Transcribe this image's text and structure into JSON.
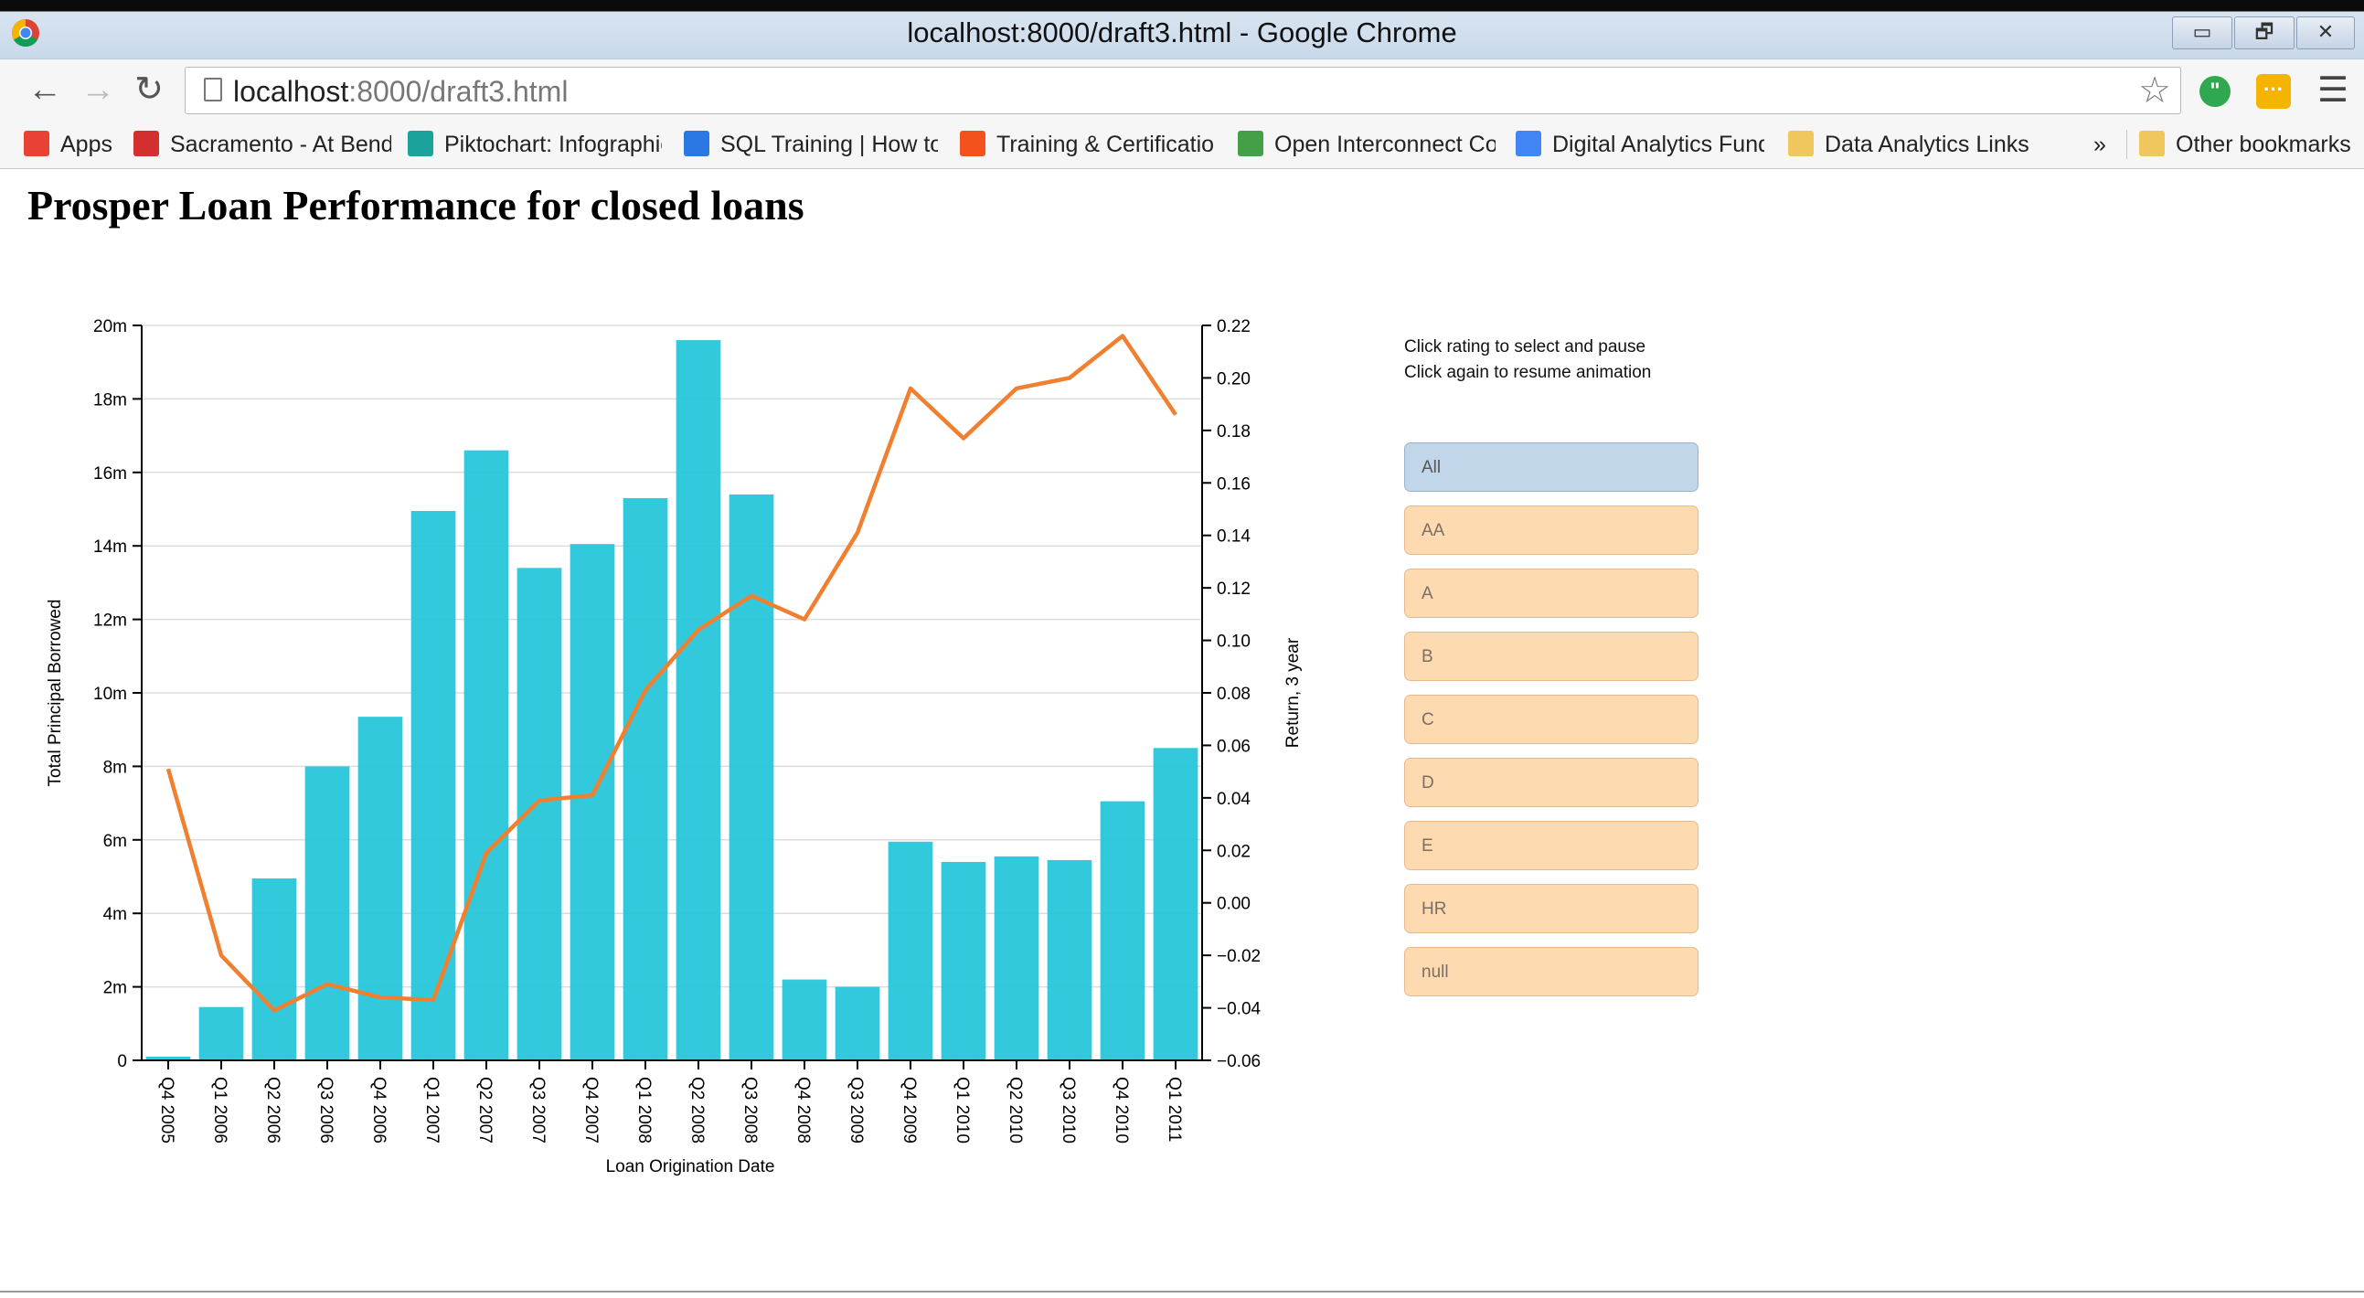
{
  "window": {
    "title": "localhost:8000/draft3.html - Google Chrome",
    "controls": [
      "▭",
      "🗗",
      "✕"
    ]
  },
  "nav": {
    "back": "←",
    "forward": "→",
    "reload": "↻"
  },
  "address_bar": {
    "host": "localhost",
    "path": ":8000/draft3.html"
  },
  "bookmarks": {
    "items": [
      {
        "label": "Apps",
        "icon_color": "#e94235"
      },
      {
        "label": "Sacramento - At Bend",
        "icon_color": "#d32f2f"
      },
      {
        "label": "Piktochart: Infographic",
        "icon_color": "#1aa39a"
      },
      {
        "label": "SQL Training | How to",
        "icon_color": "#2b78e4"
      },
      {
        "label": "Training & Certificatio",
        "icon_color": "#f4511e"
      },
      {
        "label": "Open Interconnect Co",
        "icon_color": "#43a047"
      },
      {
        "label": "Digital Analytics Fund",
        "icon_color": "#4285f4"
      },
      {
        "label": "Data Analytics Links",
        "icon_color": "#f0c75e"
      }
    ],
    "overflow": "»",
    "other": {
      "label": "Other bookmarks",
      "icon_color": "#f0c75e"
    }
  },
  "page": {
    "title": "Prosper Loan Performance for closed loans",
    "instructions": [
      "Click rating to select and pause",
      "Click again to resume animation"
    ],
    "ratings": [
      "All",
      "AA",
      "A",
      "B",
      "C",
      "D",
      "E",
      "HR",
      "null"
    ],
    "selected_rating": "All"
  },
  "chart_data": {
    "type": "bar",
    "xlabel": "Loan Origination Date",
    "ylabel": "Total Principal Borrowed",
    "y2label": "Return, 3 year",
    "categories": [
      "Q4 2005",
      "Q1 2006",
      "Q2 2006",
      "Q3 2006",
      "Q4 2006",
      "Q1 2007",
      "Q2 2007",
      "Q3 2007",
      "Q4 2007",
      "Q1 2008",
      "Q2 2008",
      "Q3 2008",
      "Q4 2008",
      "Q3 2009",
      "Q4 2009",
      "Q1 2010",
      "Q2 2010",
      "Q3 2010",
      "Q4 2010",
      "Q1 2011"
    ],
    "series": [
      {
        "type": "bar",
        "axis": "left",
        "color": "#22c4d9",
        "values": [
          0.1,
          1.45,
          4.95,
          8.0,
          9.35,
          14.95,
          16.6,
          13.4,
          14.05,
          15.3,
          19.6,
          15.4,
          2.2,
          2.0,
          5.95,
          5.4,
          5.55,
          5.45,
          7.05,
          8.5
        ]
      },
      {
        "type": "line",
        "axis": "right",
        "color": "#f08030",
        "values": [
          0.051,
          -0.02,
          -0.041,
          -0.031,
          -0.036,
          -0.037,
          0.019,
          0.039,
          0.041,
          0.081,
          0.104,
          0.117,
          0.108,
          0.141,
          0.196,
          0.177,
          0.196,
          0.2,
          0.216,
          0.186
        ]
      }
    ],
    "ylim": [
      0,
      20
    ],
    "y_unit": "m",
    "yticks": [
      0,
      2,
      4,
      6,
      8,
      10,
      12,
      14,
      16,
      18,
      20
    ],
    "ytick_labels": [
      "0",
      "2m",
      "4m",
      "6m",
      "8m",
      "10m",
      "12m",
      "14m",
      "16m",
      "18m",
      "20m"
    ],
    "y2lim": [
      -0.06,
      0.22
    ],
    "y2ticks": [
      "−0.06",
      "−0.04",
      "−0.02",
      "0.00",
      "0.02",
      "0.04",
      "0.06",
      "0.08",
      "0.10",
      "0.12",
      "0.14",
      "0.16",
      "0.18",
      "0.20",
      "0.22"
    ],
    "grid": true
  }
}
